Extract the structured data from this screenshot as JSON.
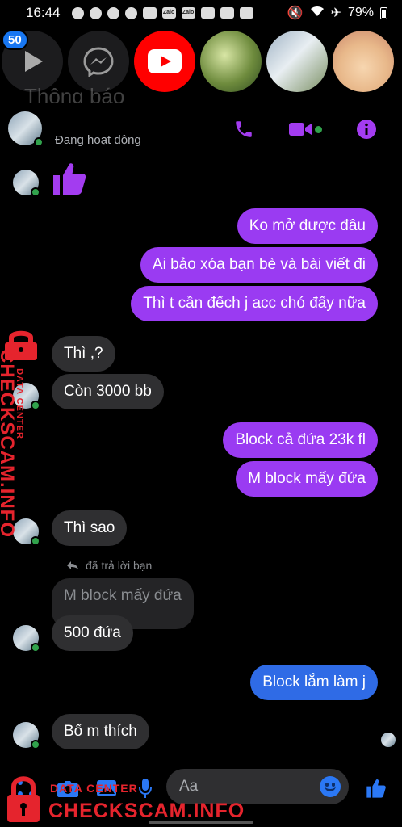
{
  "status_bar": {
    "time": "16:44",
    "battery": "79%",
    "app_icon_labels": [
      "Zalo",
      "Zalo"
    ]
  },
  "chat_heads": {
    "badge_count": "50"
  },
  "background_title": "Thông báo",
  "header": {
    "status": "Đang hoạt động"
  },
  "messages": [
    {
      "side": "out",
      "text": "Ko mở được đâu"
    },
    {
      "side": "out",
      "text": "Ai bảo xóa bạn bè và bài viết đi"
    },
    {
      "side": "out",
      "text": "Thì t cần đếch j acc chó đấy nữa"
    },
    {
      "side": "in",
      "text": "Thì ,?"
    },
    {
      "side": "in",
      "text": "Còn 3000 bb"
    },
    {
      "side": "out",
      "text": "Block cả đứa 23k fl"
    },
    {
      "side": "out",
      "text": "M block mấy đứa"
    },
    {
      "side": "in",
      "text": "Thì sao"
    },
    {
      "side": "in",
      "reply_label": "đã trả lời bạn",
      "quoted": "M block mấy đứa",
      "text": "500 đứa"
    },
    {
      "side": "out",
      "text": "Block lắm làm j"
    },
    {
      "side": "in",
      "text": "Bố m thích"
    }
  ],
  "composer": {
    "placeholder": "Aa"
  },
  "watermark": {
    "brand": "CHECKSCAM.INFO",
    "sub": "DATA CENTER"
  },
  "colors": {
    "outgoing": "#9a3bf2",
    "outgoing_last": "#2f6be6",
    "incoming": "#2f2f31",
    "accent": "#a33cf0",
    "online": "#31a24c",
    "like_blue": "#2b78f5"
  }
}
